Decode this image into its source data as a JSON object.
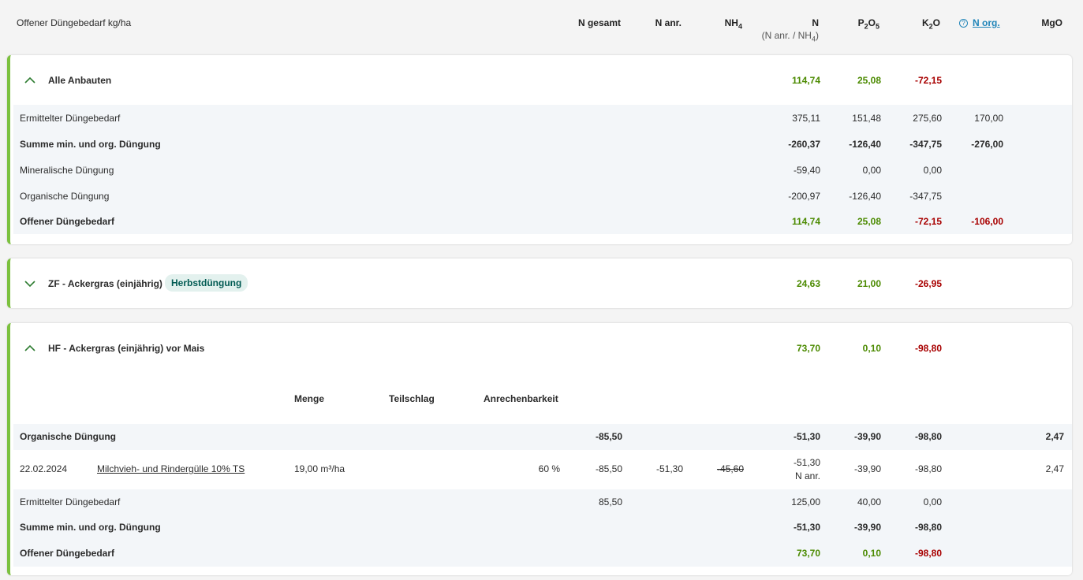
{
  "header": {
    "title": "Offener Düngebedarf kg/ha",
    "col_n_gesamt": "N gesamt",
    "col_n_anr": "N anr.",
    "col_nh4": "NH",
    "col_nh4_sub": "4",
    "col_n": "N",
    "col_n_sub_a": "(N anr. / NH",
    "col_n_sub_b": "4",
    "col_n_sub_c": ")",
    "col_p_a": "P",
    "col_p_b": "2",
    "col_p_c": "O",
    "col_p_d": "5",
    "col_k_a": "K",
    "col_k_b": "2",
    "col_k_c": "O",
    "col_norg": "N org.",
    "col_mgo": "MgO"
  },
  "alle": {
    "title": "Alle Anbauten",
    "n": "114,74",
    "p": "25,08",
    "k": "-72,15",
    "rows": [
      {
        "label": "Ermittelter Düngebedarf",
        "n": "375,11",
        "p": "151,48",
        "k": "275,60",
        "norg": "170,00"
      },
      {
        "label": "Summe min. und org. Düngung",
        "n": "-260,37",
        "p": "-126,40",
        "k": "-347,75",
        "norg": "-276,00"
      },
      {
        "label": "Mineralische Düngung",
        "n": "-59,40",
        "p": "0,00",
        "k": "0,00"
      },
      {
        "label": "Organische Düngung",
        "n": "-200,97",
        "p": "-126,40",
        "k": "-347,75"
      },
      {
        "label": "Offener Düngebedarf",
        "n": "114,74",
        "p": "25,08",
        "k": "-72,15",
        "norg": "-106,00"
      }
    ]
  },
  "zf": {
    "title": "ZF - Ackergras (einjährig)",
    "badge": "Herbstdüngung",
    "n": "24,63",
    "p": "21,00",
    "k": "-26,95"
  },
  "hf": {
    "title": "HF - Ackergras (einjährig) vor Mais",
    "n": "73,70",
    "p": "0,10",
    "k": "-98,80",
    "sub_headers": {
      "menge": "Menge",
      "teilschlag": "Teilschlag",
      "anrechenbarkeit": "Anrechenbarkeit"
    },
    "org": {
      "label": "Organische Düngung",
      "n_gesamt": "-85,50",
      "n": "-51,30",
      "p": "-39,90",
      "k": "-98,80",
      "mgo": "2,47"
    },
    "entry": {
      "date": "22.02.2024",
      "product": "Milchvieh- und Rindergülle 10% TS",
      "menge": "19,00 m³/ha",
      "anrechenbarkeit": "60 %",
      "n_gesamt": "-85,50",
      "n_anr": "-51,30",
      "nh4": "-45,60",
      "n": "-51,30",
      "n_note": "N anr.",
      "p": "-39,90",
      "k": "-98,80",
      "mgo": "2,47"
    },
    "rows": [
      {
        "label": "Ermittelter Düngebedarf",
        "n_gesamt": "85,50",
        "n": "125,00",
        "p": "40,00",
        "k": "0,00"
      },
      {
        "label": "Summe min. und org. Düngung",
        "n": "-51,30",
        "p": "-39,90",
        "k": "-98,80"
      },
      {
        "label": "Offener Düngebedarf",
        "n": "73,70",
        "p": "0,10",
        "k": "-98,80"
      }
    ]
  }
}
